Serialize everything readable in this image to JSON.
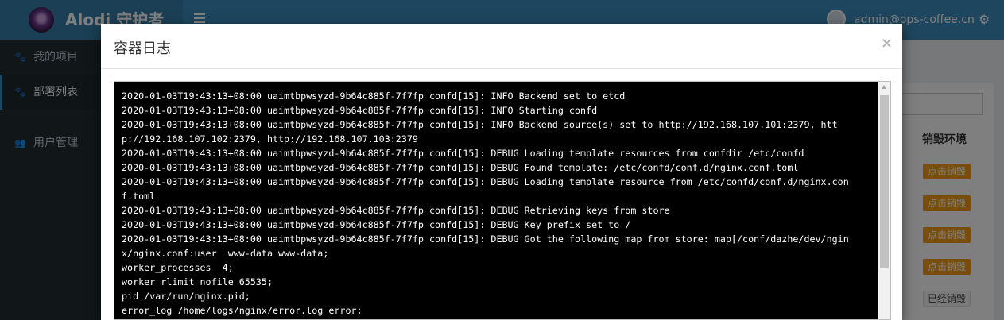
{
  "app": {
    "title": "Alodi 守护者"
  },
  "header": {
    "user_email": "admin@ops-coffee.cn",
    "settings_icon": "gears-icon"
  },
  "sidebar": {
    "items": [
      {
        "label": "我的项目",
        "icon": "paw-icon"
      },
      {
        "label": "部署列表",
        "icon": "paw-icon",
        "active": true
      },
      {
        "label": "用户管理",
        "icon": "users-icon"
      }
    ]
  },
  "background_table": {
    "column_header": "销毁环境",
    "row_actions": [
      "点击销毁",
      "点击销毁",
      "点击销毁",
      "点击销毁",
      "已经销毁"
    ]
  },
  "modal": {
    "title": "容器日志",
    "close_label": "×",
    "log_lines": [
      "2020-01-03T19:43:13+08:00 uaimtbpwsyzd-9b64c885f-7f7fp confd[15]: INFO Backend set to etcd",
      "2020-01-03T19:43:13+08:00 uaimtbpwsyzd-9b64c885f-7f7fp confd[15]: INFO Starting confd",
      "2020-01-03T19:43:13+08:00 uaimtbpwsyzd-9b64c885f-7f7fp confd[15]: INFO Backend source(s) set to http://192.168.107.101:2379, htt",
      "p://192.168.107.102:2379, http://192.168.107.103:2379",
      "2020-01-03T19:43:13+08:00 uaimtbpwsyzd-9b64c885f-7f7fp confd[15]: DEBUG Loading template resources from confdir /etc/confd",
      "2020-01-03T19:43:13+08:00 uaimtbpwsyzd-9b64c885f-7f7fp confd[15]: DEBUG Found template: /etc/confd/conf.d/nginx.conf.toml",
      "2020-01-03T19:43:13+08:00 uaimtbpwsyzd-9b64c885f-7f7fp confd[15]: DEBUG Loading template resource from /etc/confd/conf.d/nginx.con",
      "f.toml",
      "2020-01-03T19:43:13+08:00 uaimtbpwsyzd-9b64c885f-7f7fp confd[15]: DEBUG Retrieving keys from store",
      "2020-01-03T19:43:13+08:00 uaimtbpwsyzd-9b64c885f-7f7fp confd[15]: DEBUG Key prefix set to /",
      "2020-01-03T19:43:13+08:00 uaimtbpwsyzd-9b64c885f-7f7fp confd[15]: DEBUG Got the following map from store: map[/conf/dazhe/dev/ngin",
      "x/nginx.conf:user  www-data www-data;",
      "worker_processes  4;",
      "worker_rlimit_nofile 65535;",
      "pid /var/run/nginx.pid;",
      "error_log /home/logs/nginx/error.log error;"
    ]
  }
}
